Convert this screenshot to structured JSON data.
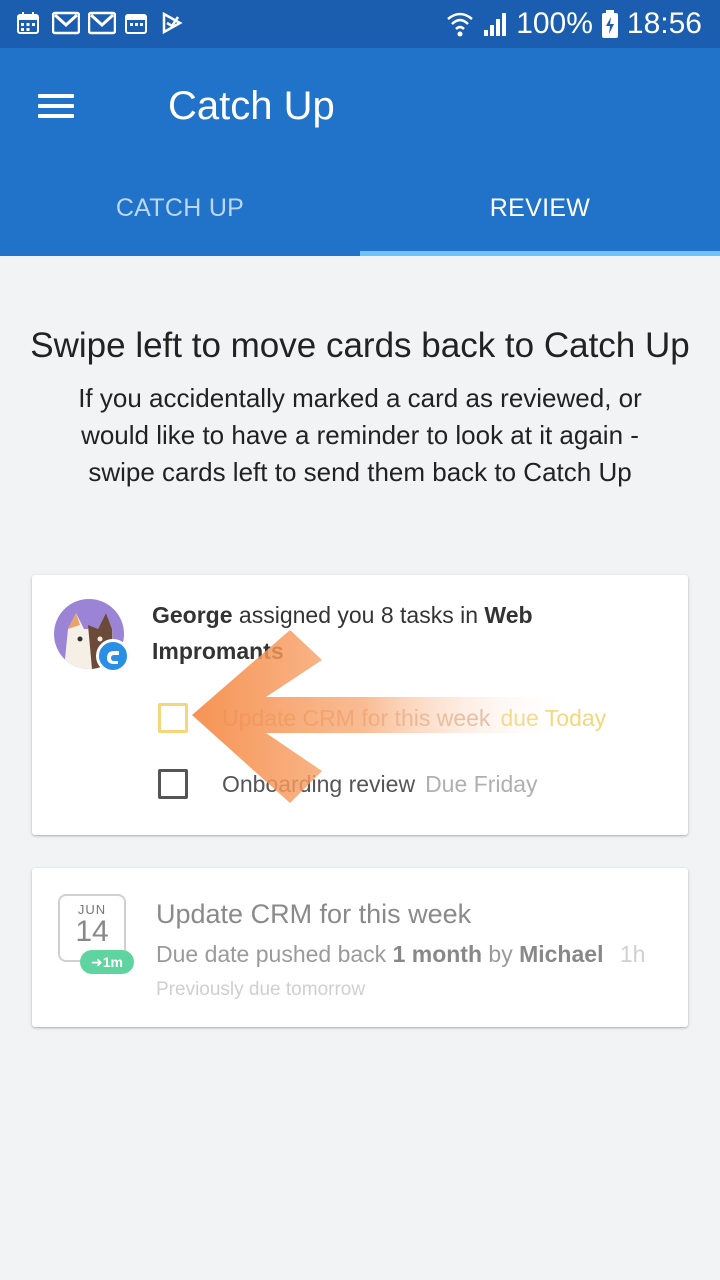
{
  "status_bar": {
    "battery": "100%",
    "time": "18:56",
    "icons": [
      "calendar-icon",
      "gmail-icon",
      "gmail-icon",
      "calendar-icon",
      "send-icon",
      "wifi-icon",
      "signal-icon",
      "battery-icon"
    ]
  },
  "app_bar": {
    "title": "Catch Up",
    "tabs": [
      {
        "label": "CATCH UP",
        "active": false
      },
      {
        "label": "REVIEW",
        "active": true
      }
    ]
  },
  "intro": {
    "title": "Swipe left to move cards back to Catch Up",
    "body": "If you accidentally marked a card as reviewed, or would like to have a reminder to look at it again - swipe cards left to send them back to Catch Up"
  },
  "card1": {
    "assigner": "George",
    "assign_text": "assigned you 8 tasks in",
    "project": "Web Impromants",
    "tasks": [
      {
        "name": "Update CRM for this week",
        "due": "due Today"
      },
      {
        "name": "Onboarding review",
        "due": "Due Friday"
      }
    ]
  },
  "card2": {
    "calendar": {
      "month": "JUN",
      "day": "14",
      "badge": "1m"
    },
    "title": "Update CRM for this week",
    "sub_prefix": "Due date pushed back",
    "sub_amount": "1 month",
    "sub_by": "by",
    "sub_user": "Michael",
    "time_ago": "1h",
    "previous": "Previously due tomorrow"
  },
  "colors": {
    "status_bar": "#1b5eb0",
    "app_bar": "#2173c9",
    "tab_indicator": "#6dc2fb",
    "swipe_arrow": "#f58a45",
    "due_today": "#f3d77a",
    "badge_green": "#5fd3a0"
  }
}
